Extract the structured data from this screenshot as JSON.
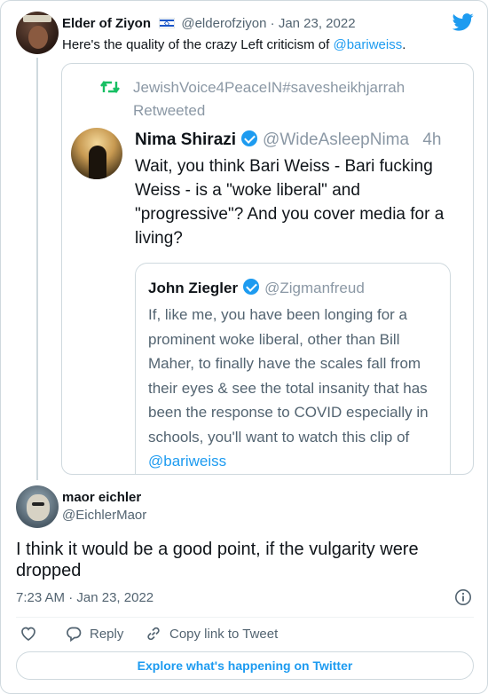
{
  "parent_tweet": {
    "author_name": "Elder of Ziyon",
    "author_handle": "@elderofziyon",
    "date": "Jan 23, 2022",
    "separator": "·",
    "text_prefix": "Here's the quality of the crazy Left criticism of ",
    "text_mention": "@bariweiss",
    "text_suffix": "."
  },
  "embedded_screenshot": {
    "retweet_label": "JewishVoice4PeaceIN#savesheikhjarrah",
    "retweet_label2": "Retweeted",
    "tweet": {
      "author_name": "Nima Shirazi",
      "author_handle": "@WideAsleepNima",
      "time": "4h",
      "text": "Wait, you think Bari Weiss - Bari fucking Weiss - is a \"woke liberal\" and \"progressive\"? And you cover media for a living?"
    },
    "quoted": {
      "author_name": "John Ziegler",
      "author_handle": "@Zigmanfreud",
      "text": "If, like me, you have been longing for a prominent woke liberal, other than Bill Maher, to finally have the scales fall from their eyes & see the total insanity that has been the response to COVID especially in schools, you'll want to watch this clip of ",
      "mention": "@bariweiss"
    }
  },
  "reply_tweet": {
    "author_name": "maor eichler",
    "author_handle": "@EichlerMaor",
    "text": "I think it would be a good point, if the vulgarity were dropped",
    "time": "7:23 AM",
    "date": "Jan 23, 2022",
    "separator": "·"
  },
  "actions": {
    "reply_label": "Reply",
    "copy_label": "Copy link to Tweet"
  },
  "explore_label": "Explore what's happening on Twitter",
  "colors": {
    "accent": "#1d9bf0",
    "text": "#0f1419",
    "muted": "#536471",
    "border": "#cfd9de"
  }
}
